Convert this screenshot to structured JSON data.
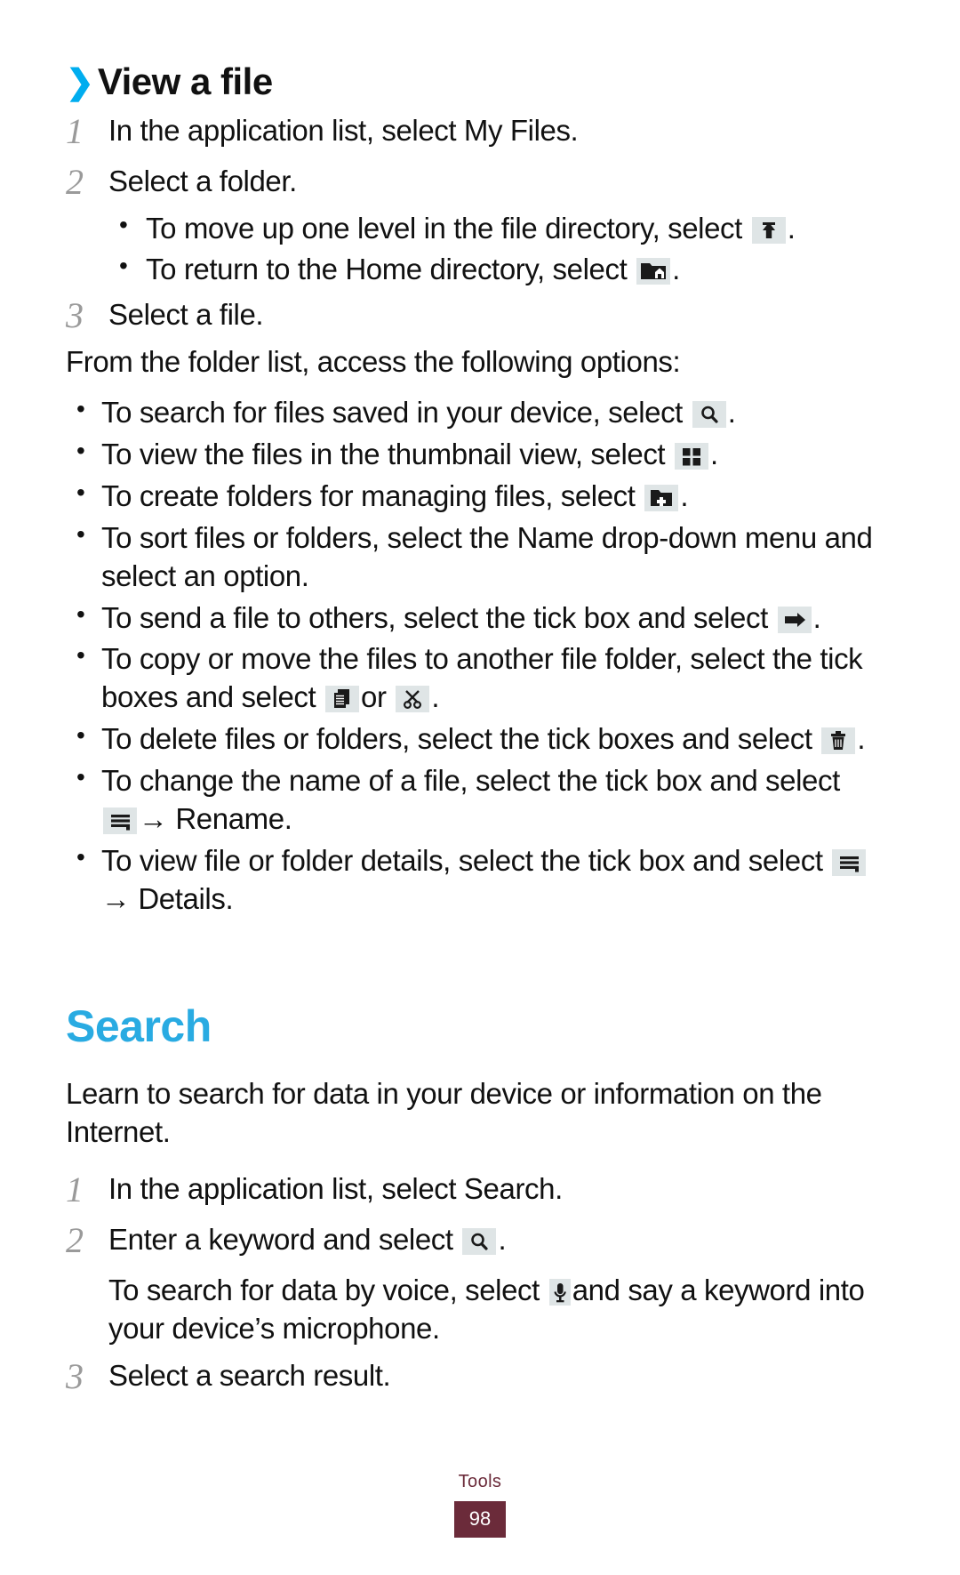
{
  "document": {
    "section_heading": "View a file",
    "chevron": "〉",
    "main_heading": "Search"
  },
  "view_a_file": {
    "steps": [
      {
        "num": "1",
        "text": "In the application list, select My Files."
      },
      {
        "num": "2",
        "text": "Select a folder."
      },
      {
        "num": "3",
        "text": "Select a file."
      }
    ],
    "step2_bullets": [
      {
        "before": "To move up one level in the file directory, select",
        "icon": "move-up-level-icon",
        "after": "."
      },
      {
        "before": "To return to the Home directory, select",
        "icon": "home-directory-icon",
        "after": "."
      }
    ],
    "options_intro": "From the folder list, access the following options:",
    "option_bullets": [
      {
        "before": "To search for files saved in your device, select",
        "icon": "search-icon",
        "after": "."
      },
      {
        "before": "To view the files in the thumbnail view, select",
        "icon": "thumbnail-view-icon",
        "after": "."
      },
      {
        "before": "To create folders for managing files, select",
        "icon": "create-folder-icon",
        "after": "."
      },
      {
        "before": "To sort files or folders, select the Name drop-down menu and select an option.",
        "icon": null,
        "after": ""
      },
      {
        "before": "To send a file to others, select the tick box and select",
        "icon": "send-icon",
        "after": "."
      },
      {
        "before": "To copy or move the files to another file folder, select the tick boxes and select",
        "icon": "copy-icon",
        "middle": "or",
        "icon2": "cut-icon",
        "after": "."
      },
      {
        "before": "To delete files or folders, select the tick boxes and select",
        "icon": "delete-icon",
        "after": "."
      },
      {
        "before": "To change the name of a file, select the tick box and select",
        "icon": "menu-icon",
        "after": "→ Rename."
      },
      {
        "before": "To view file or folder details, select the tick box and select",
        "icon": "menu-icon",
        "after": "→ Details."
      }
    ]
  },
  "search": {
    "intro": "Learn to search for data in your device or information on the Internet.",
    "steps": [
      {
        "num": "1",
        "text": "In the application list, select Search."
      },
      {
        "num": "2",
        "text_before": "Enter a keyword and select",
        "icon": "search-icon",
        "text_after": "."
      },
      {
        "num": "3",
        "text": "Select a search result."
      }
    ],
    "voice_note_before": "To search for data by voice, select",
    "voice_icon": "microphone-icon",
    "voice_note_after": "and say a keyword into your device’s microphone."
  },
  "footer": {
    "section": "Tools",
    "page_number": "98"
  },
  "colors": {
    "heading_blue": "#29abe2",
    "chevron_blue": "#00adef",
    "footer_maroon": "#6b2b3a",
    "icon_bg": "#dfe5e6",
    "step_number_gray": "#9a9a9a"
  }
}
